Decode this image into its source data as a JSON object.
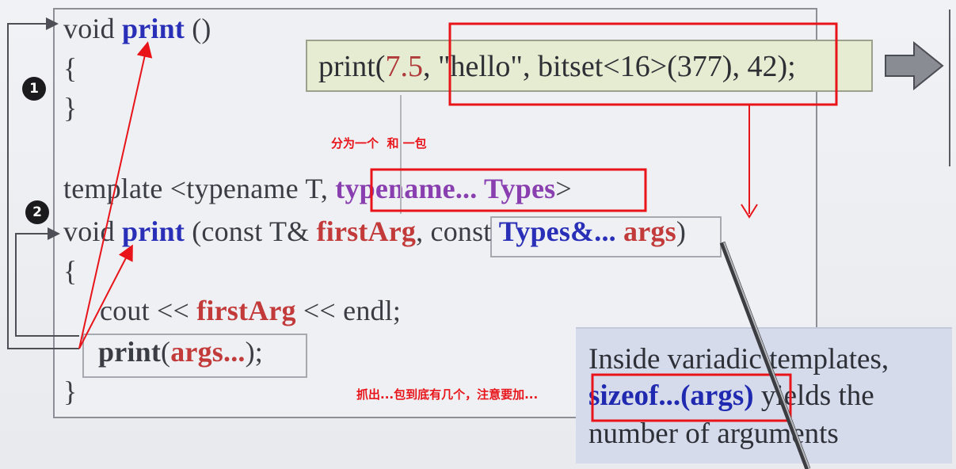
{
  "slide": {
    "call_line": {
      "prefix": "print(",
      "num": "7.5",
      "rest": ", \"hello\", bitset<16>(377), 42);"
    },
    "code": {
      "l1_void": "void ",
      "l1_print": "print",
      "l1_parens": " ()",
      "l2_open": "{",
      "l3_close": "}",
      "template_prefix": "template <typename T, ",
      "template_pack": "typename... Types",
      "template_suffix": ">",
      "void2": "void ",
      "print2": "print",
      "sig_open": " (const T& ",
      "first_arg": "firstArg",
      "sig_mid": ", const ",
      "types_pack": "Types&...",
      "sig_space": " ",
      "args": "args",
      "sig_close": ")",
      "body_open": "{",
      "cout_prefix": "cout << ",
      "cout_first": "firstArg",
      "cout_suffix": " << endl;",
      "print_call": "print",
      "print_open": "(",
      "print_args": "args...",
      "print_close": ");",
      "body_close": "}"
    },
    "info": {
      "line1": "Inside variadic templates,",
      "sizeof": "sizeof...(args)",
      "line2_rest": " yields the",
      "line3": "number of arguments"
    },
    "badges": [
      "1",
      "2"
    ]
  },
  "annotations": {
    "split_note": "分为一个  和 一包",
    "sizeof_note": "抓出...包到底有几个，注意要加..."
  },
  "colors": {
    "annotation_red": "#e8141a",
    "function_blue": "#2a2fb8",
    "param_red": "#c23a3a",
    "pack_purple": "#8a3fb0"
  },
  "icons": [
    "right-arrow-icon",
    "pointer-stick"
  ]
}
